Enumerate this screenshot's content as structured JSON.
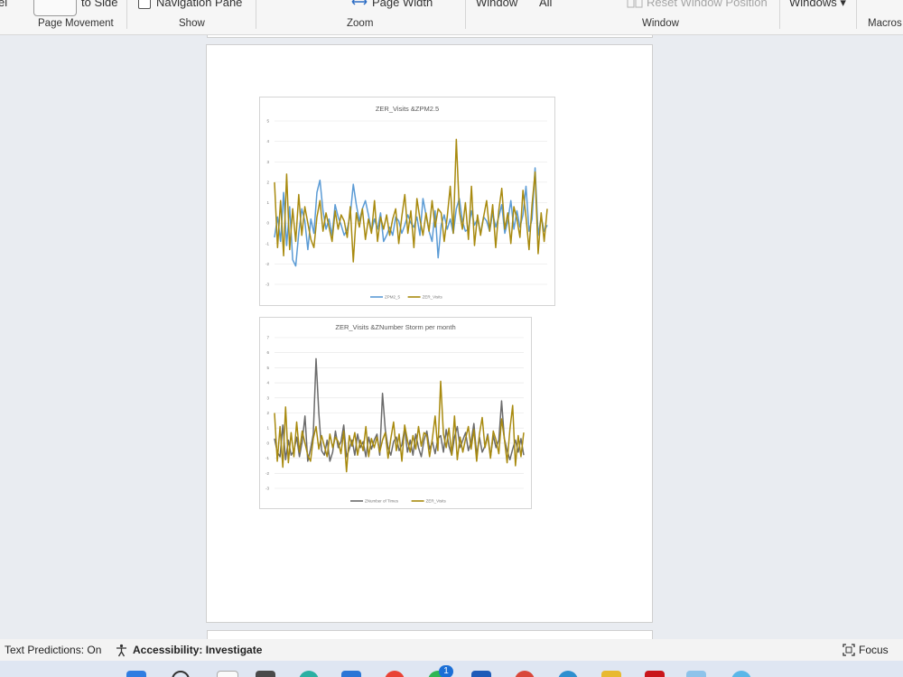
{
  "ribbon": {
    "cut_label_left": "el",
    "side_to_side_label": "to Side",
    "navigation_pane_label": "Navigation Pane",
    "page_width_label": "Page Width",
    "window_label": "Window",
    "all_label": "All",
    "reset_window_label": "Reset Window Position",
    "windows_label": "Windows",
    "windows_arrow": "▾",
    "groups": {
      "page_movement": "Page Movement",
      "show": "Show",
      "zoom": "Zoom",
      "window": "Window",
      "macros": "Macros"
    }
  },
  "chart_data": [
    {
      "type": "line",
      "title": "ZER_Visits &ZPM2.5",
      "ylim": [
        -3,
        5
      ],
      "yticks": [
        "5",
        "4",
        "3",
        "2",
        "1",
        "0",
        "-1",
        "-2",
        "-3"
      ],
      "grid": true,
      "legend_position": "bottom",
      "series": [
        {
          "name": "ZPM2_5",
          "color": "#5b9bd5",
          "values": [
            -0.7,
            0.3,
            -0.9,
            1.5,
            -1.1,
            0.8,
            -1.8,
            -2.1,
            -0.5,
            0.7,
            0.1,
            -1.3,
            0.2,
            -0.5,
            1.5,
            2.1,
            0.6,
            -0.3,
            0.2,
            -0.6,
            0.9,
            0.3,
            -0.1,
            -0.6,
            -0.3,
            0.4,
            1.9,
            0.9,
            0.1,
            0.7,
            1.1,
            0.4,
            -0.4,
            0.2,
            -0.3,
            0.5,
            -0.9,
            -0.6,
            -0.2,
            -0.6,
            0.3,
            0.1,
            -0.5,
            -0.1,
            0.4,
            0.0,
            -0.2,
            0.3,
            -0.6,
            1.2,
            0.4,
            -0.4,
            -0.9,
            0.6,
            -1.7,
            -0.1,
            0.4,
            -0.3,
            0.2,
            -0.5,
            0.7,
            1.2,
            0.1,
            -0.4,
            -0.3,
            0.6,
            -0.1,
            0.2,
            -0.5,
            0.3,
            0.1,
            -0.4,
            0.5,
            -0.2,
            0.3,
            0.9,
            -0.5,
            0.1,
            1.1,
            -0.3,
            0.6,
            -0.2,
            0.4,
            1.8,
            -0.4,
            0.2,
            2.7,
            -0.6,
            0.3,
            -0.4,
            -0.1
          ]
        },
        {
          "name": "ZER_Visits",
          "color": "#a88a0f",
          "values": [
            2.0,
            -1.2,
            1.1,
            -1.6,
            2.4,
            -1.3,
            0.7,
            -0.9,
            1.4,
            -0.6,
            0.8,
            0.0,
            -0.8,
            -1.2,
            0.3,
            1.1,
            -0.4,
            0.5,
            -0.2,
            -0.9,
            0.6,
            -0.3,
            0.4,
            0.1,
            -0.7,
            0.8,
            -1.9,
            0.5,
            -0.2,
            0.7,
            -0.8,
            0.2,
            -0.5,
            1.1,
            -0.9,
            0.3,
            -0.3,
            0.4,
            -0.6,
            0.2,
            0.7,
            -1.0,
            0.3,
            1.4,
            -0.5,
            0.6,
            -1.2,
            1.2,
            0.2,
            -0.6,
            0.5,
            -0.4,
            1.1,
            -0.2,
            0.7,
            0.5,
            -0.9,
            0.3,
            1.8,
            -0.5,
            4.1,
            0.6,
            -0.3,
            1.0,
            -0.8,
            1.8,
            -1.1,
            0.4,
            -0.6,
            0.3,
            1.1,
            -0.4,
            0.9,
            -1.2,
            0.6,
            1.7,
            -0.3,
            0.5,
            -1.0,
            0.8,
            0.2,
            -0.7,
            1.6,
            0.3,
            -1.3,
            0.9,
            2.5,
            -1.5,
            0.5,
            -0.9,
            0.7
          ]
        }
      ]
    },
    {
      "type": "line",
      "title": "ZER_Visits &ZNumber Storm per month",
      "ylim": [
        -3,
        7
      ],
      "yticks": [
        "7",
        "6",
        "5",
        "4",
        "3",
        "2",
        "1",
        "0",
        "-1",
        "-2",
        "-3"
      ],
      "grid": true,
      "legend_position": "bottom",
      "series": [
        {
          "name": "ZNumber of Times",
          "color": "#6b6b6b",
          "values": [
            0.3,
            -0.6,
            -0.9,
            1.2,
            -1.1,
            0.2,
            -0.8,
            -0.5,
            0.4,
            -0.9,
            0.1,
            1.8,
            -1.2,
            -0.4,
            0.6,
            5.6,
            2.0,
            -0.5,
            -0.8,
            0.2,
            -1.2,
            -0.6,
            0.8,
            -0.3,
            0.1,
            1.2,
            -0.9,
            -0.4,
            0.2,
            -0.8,
            0.6,
            -0.3,
            0.1,
            -0.9,
            0.4,
            -0.4,
            0.2,
            0.6,
            -0.8,
            3.3,
            0.9,
            -0.3,
            -0.8,
            0.1,
            0.4,
            -0.5,
            -0.1,
            1.0,
            -0.6,
            0.2,
            -0.8,
            0.6,
            -0.3,
            -0.9,
            0.2,
            0.8,
            -0.4,
            0.1,
            -0.7,
            0.3,
            0.5,
            -0.6,
            0.9,
            -0.2,
            -0.8,
            0.4,
            1.1,
            -0.3,
            0.2,
            0.7,
            -0.5,
            0.1,
            1.3,
            -0.8,
            0.4,
            -0.6,
            -0.2,
            0.6,
            -0.9,
            0.5,
            -0.3,
            0.2,
            2.8,
            0.3,
            -0.5,
            -1.1,
            -0.4,
            0.2,
            -0.6,
            0.3,
            -0.8
          ]
        },
        {
          "name": "ZER_Visits",
          "color": "#a88a0f",
          "values": [
            2.0,
            -1.2,
            1.1,
            -1.6,
            2.4,
            -1.3,
            0.7,
            -0.9,
            1.4,
            -0.6,
            0.8,
            0.0,
            -0.8,
            -1.2,
            0.3,
            1.1,
            -0.4,
            0.5,
            -0.2,
            -0.9,
            0.6,
            -0.3,
            0.4,
            0.1,
            -0.7,
            0.8,
            -1.9,
            0.5,
            -0.2,
            0.7,
            -0.8,
            0.2,
            -0.5,
            1.1,
            -0.9,
            0.3,
            -0.3,
            0.4,
            -0.6,
            0.2,
            0.7,
            -1.0,
            0.3,
            1.4,
            -0.5,
            0.6,
            -1.2,
            1.2,
            0.2,
            -0.6,
            0.5,
            -0.4,
            1.1,
            -0.2,
            0.7,
            0.5,
            -0.9,
            0.3,
            1.8,
            -0.5,
            4.1,
            0.6,
            -0.3,
            1.0,
            -0.8,
            1.8,
            -1.1,
            0.4,
            -0.6,
            0.3,
            1.1,
            -0.4,
            0.9,
            -1.2,
            0.6,
            1.7,
            -0.3,
            0.5,
            -1.0,
            0.8,
            0.2,
            -0.7,
            1.6,
            0.3,
            -1.3,
            0.9,
            2.5,
            -1.5,
            0.5,
            -0.9,
            0.7
          ]
        }
      ]
    }
  ],
  "statusbar": {
    "text_predictions": "Text Predictions: On",
    "accessibility": "Accessibility: Investigate",
    "focus": "Focus"
  },
  "taskbar": {
    "badge_count": "1",
    "icons": [
      "start-icon",
      "search-icon",
      "file-icon",
      "task-view-icon",
      "edge-icon",
      "store-icon",
      "chrome-icon",
      "whatsapp-icon",
      "word-icon",
      "chrome-profile-icon",
      "teams-icon",
      "file-explorer-icon",
      "acrobat-icon",
      "word-active-icon",
      "photos-icon"
    ]
  }
}
